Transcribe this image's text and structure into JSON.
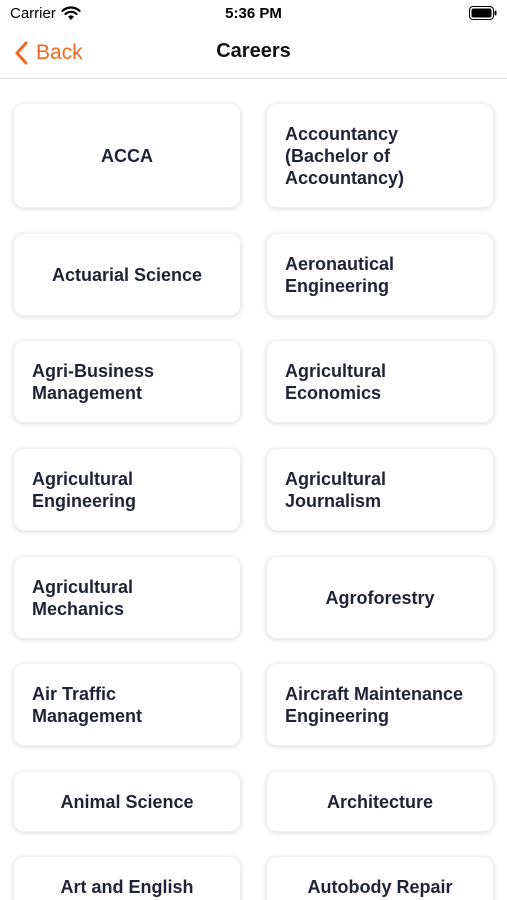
{
  "status_bar": {
    "carrier": "Carrier",
    "time": "5:36 PM"
  },
  "nav": {
    "back_label": "Back",
    "title": "Careers"
  },
  "colors": {
    "accent": "#f26a21",
    "card_text": "#1f2336"
  },
  "careers": [
    "ACCA",
    "Accountancy (Bachelor of Accountancy)",
    "Actuarial Science",
    "Aeronautical Engineering",
    "Agri-Business Management",
    "Agricultural Economics",
    "Agricultural Engineering",
    "Agricultural Journalism",
    "Agricultural Mechanics",
    "Agroforestry",
    "Air Traffic Management",
    "Aircraft Maintenance Engineering",
    "Animal Science",
    "Architecture",
    "Art and English",
    "Autobody Repair"
  ]
}
